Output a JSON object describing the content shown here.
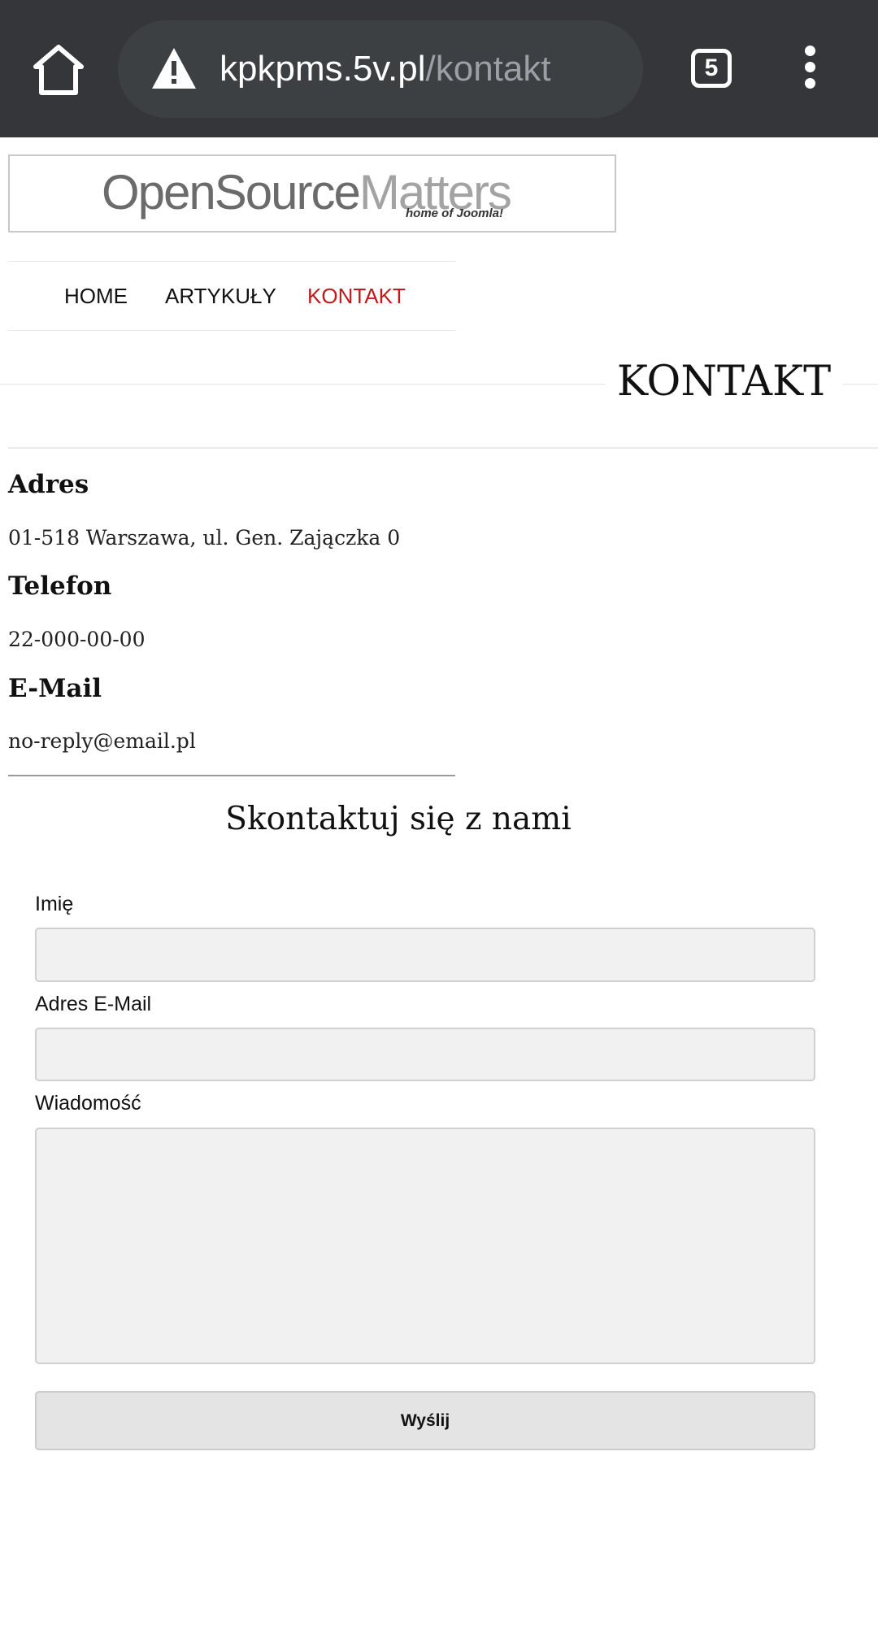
{
  "browser": {
    "url_host": "kpkpms.5v.pl",
    "url_path": "/kontakt",
    "tab_count": "5",
    "icons": [
      "home-icon",
      "warning-icon",
      "tabs-icon",
      "more-vert-icon"
    ]
  },
  "logo": {
    "main_dark": "OpenSource",
    "main_light": "Matters",
    "tagline": "home of Joomla!"
  },
  "nav": {
    "items": [
      {
        "label": "HOME",
        "active": false
      },
      {
        "label": "ARTYKUŁY",
        "active": false
      },
      {
        "label": "KONTAKT",
        "active": true
      }
    ],
    "active_color": "#c01a1a"
  },
  "page": {
    "title": "KONTAKT"
  },
  "contact": {
    "address_label": "Adres",
    "address_value": "01-518 Warszawa, ul. Gen. Zajączka 0",
    "phone_label": "Telefon",
    "phone_value": "22-000-00-00",
    "email_label": "E-Mail",
    "email_value": "no-reply@email.pl"
  },
  "form": {
    "title": "Skontaktuj się z nami",
    "name_label": "Imię",
    "name_value": "",
    "email_label": "Adres E-Mail",
    "email_value": "",
    "message_label": "Wiadomość",
    "message_value": "",
    "submit_label": "Wyślij"
  }
}
